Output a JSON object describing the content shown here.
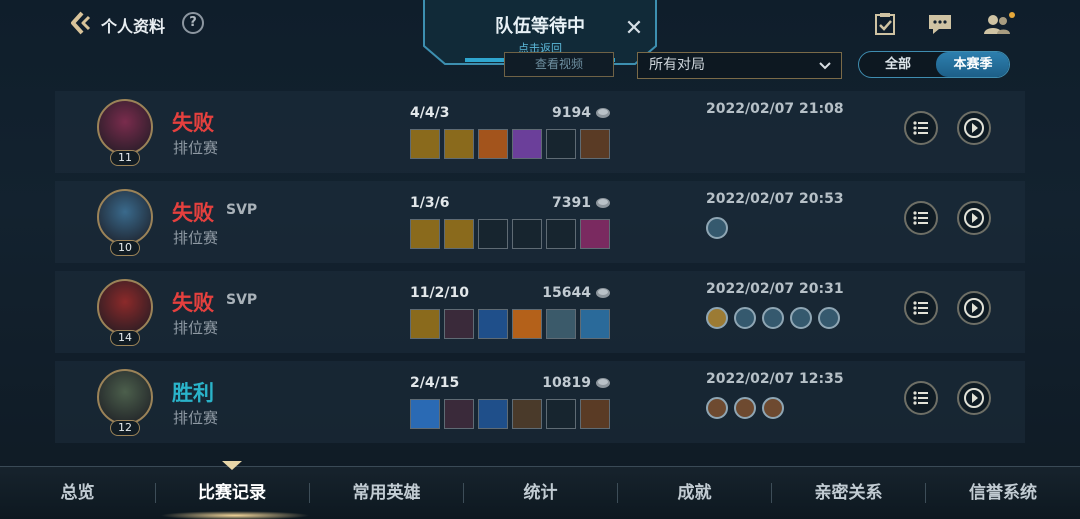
{
  "header": {
    "title": "个人资料",
    "help_label": "?",
    "icons": [
      "back-icon",
      "help-icon",
      "checklist-icon",
      "chat-icon",
      "friends-icon"
    ]
  },
  "queue": {
    "title": "队伍等待中",
    "subtitle": "点击返回",
    "close_label": "✕"
  },
  "filters": {
    "ghost_label": "查看视频",
    "dropdown_value": "所有对局",
    "segments": [
      "全部",
      "本赛季"
    ],
    "active_segment": "本赛季"
  },
  "matches": [
    {
      "result": "失败",
      "result_type": "loss",
      "svp": "",
      "mode": "排位赛",
      "level": "11",
      "kda": "4/4/3",
      "gold": "9194",
      "datetime": "2022/02/07 21:08",
      "avatar_color": "#7a2c4d",
      "items": [
        "gold-staff",
        "gold-staff",
        "orange-item",
        "purple-item",
        "empty",
        "boots"
      ],
      "badges": []
    },
    {
      "result": "失败",
      "result_type": "loss",
      "svp": "SVP",
      "mode": "排位赛",
      "level": "10",
      "kda": "1/3/6",
      "gold": "7391",
      "datetime": "2022/02/07 20:53",
      "avatar_color": "#3a6a8c",
      "items": [
        "gold-staff",
        "gold-staff",
        "empty",
        "empty",
        "empty",
        "mask"
      ],
      "badges": [
        "flag"
      ]
    },
    {
      "result": "失败",
      "result_type": "loss",
      "svp": "SVP",
      "mode": "排位赛",
      "level": "14",
      "kda": "11/2/10",
      "gold": "15644",
      "datetime": "2022/02/07 20:31",
      "avatar_color": "#8c2a2a",
      "items": [
        "gold-staff",
        "dark-blade",
        "blue-sword",
        "sun-orb",
        "armor",
        "hammer"
      ],
      "badges": [
        "gold-s",
        "3",
        "flag",
        "w",
        "percent"
      ]
    },
    {
      "result": "胜利",
      "result_type": "win",
      "svp": "",
      "mode": "排位赛",
      "level": "12",
      "kda": "2/4/15",
      "gold": "10819",
      "datetime": "2022/02/07 12:35",
      "avatar_color": "#4c5f4c",
      "items": [
        "blue-wing",
        "dark-blade",
        "blue-sword",
        "gauntlet",
        "empty",
        "boots"
      ],
      "badges": [
        "bronze-1",
        "bronze-2",
        "bronze-3"
      ]
    }
  ],
  "nav": {
    "items": [
      "总览",
      "比赛记录",
      "常用英雄",
      "统计",
      "成就",
      "亲密关系",
      "信誉系统"
    ],
    "active": "比赛记录"
  },
  "colors": {
    "loss": "#e5403e",
    "win": "#2ab3c9",
    "gold_border": "#9b8358",
    "accent_blue": "#2d7fae"
  }
}
